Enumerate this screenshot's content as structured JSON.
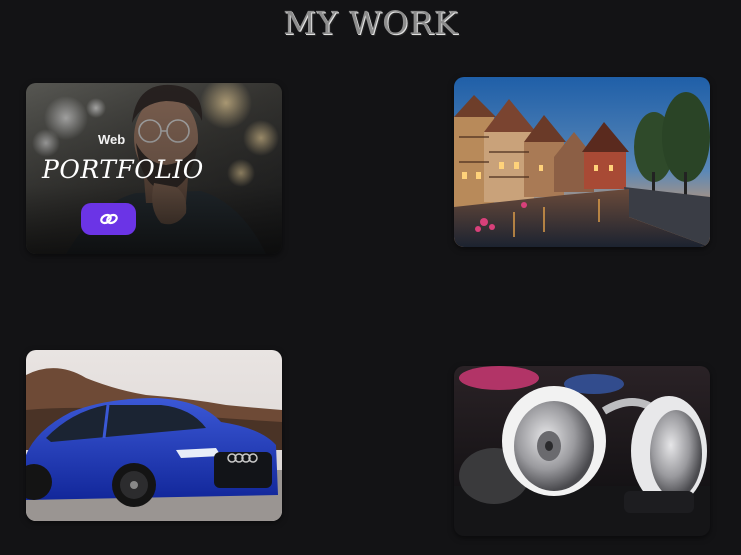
{
  "section": {
    "title": "MY WORK"
  },
  "cards": [
    {
      "image": "portrait-man-glasses",
      "overlay": {
        "subtitle": "Web",
        "title": "PORTFOLIO",
        "link_icon": "link-icon"
      }
    },
    {
      "image": "canal-town-dusk"
    },
    {
      "image": "blue-audi-sedan"
    },
    {
      "image": "silver-headphones"
    }
  ],
  "colors": {
    "background": "#131315",
    "accent": "#6b34e6",
    "title": "#8d8d8d"
  }
}
